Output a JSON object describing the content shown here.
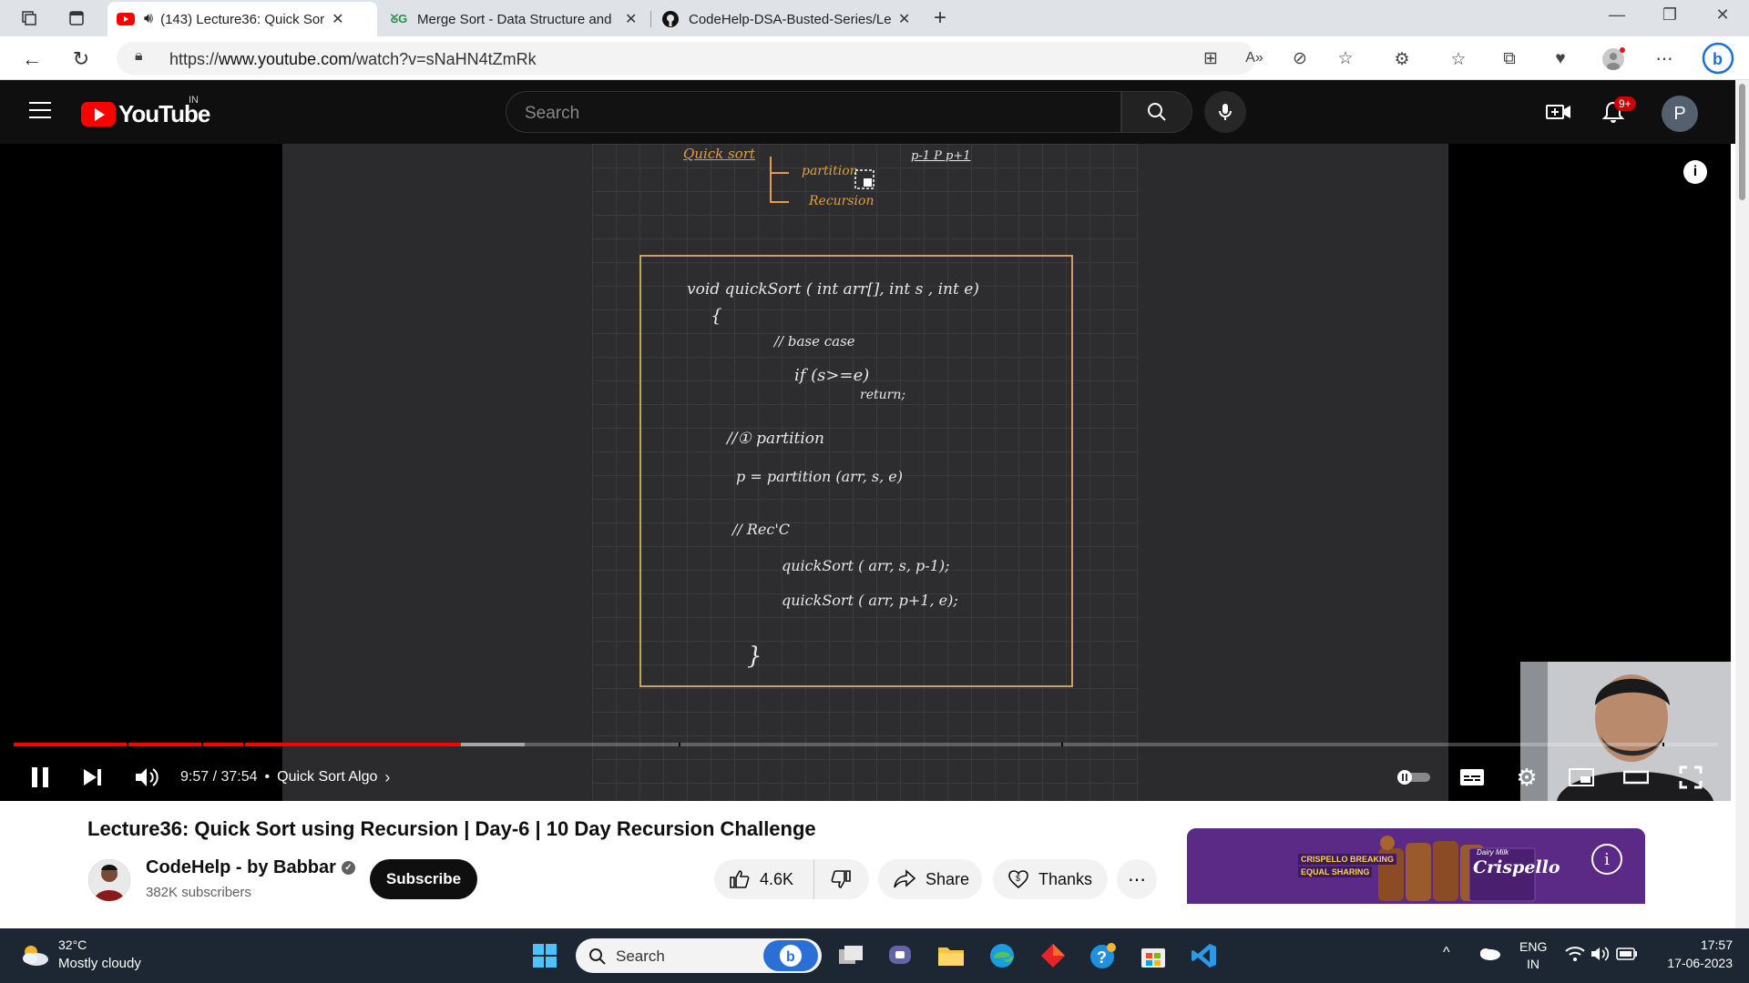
{
  "browser": {
    "tabs": [
      {
        "title": "(143) Lecture36: Quick Sort",
        "active": true
      },
      {
        "title": "Merge Sort - Data Structure and",
        "active": false
      },
      {
        "title": "CodeHelp-DSA-Busted-Series/Le",
        "active": false
      }
    ],
    "url_prefix": "https://",
    "url_domain": "www.youtube.com",
    "url_path": "/watch?v=sNaHN4tZmRk"
  },
  "youtube": {
    "logo_text": "YouTube",
    "country": "IN",
    "search_placeholder": "Search",
    "notification_count": "9+",
    "avatar_letter": "P"
  },
  "player": {
    "board": {
      "heading": "Quick sort",
      "branch1": "partition",
      "branch2": "Recursion",
      "top_right": "p-1  P  p+1",
      "code": [
        "void  quickSort ( int arr[], int s , int e)",
        "{",
        "// base case",
        "if (s>=e)",
        "return;",
        "//① partition",
        "p  = partition (arr, s, e)",
        "//  Rec'C",
        "quickSort ( arr, s,  p-1);",
        "quickSort ( arr, p+1, e);",
        "}"
      ]
    },
    "current_time": "9:57",
    "duration": "37:54",
    "time_display": "9:57 / 37:54",
    "chapter": "Quick Sort Algo",
    "progress_fraction": 0.2625,
    "buffered_fraction": 0.3
  },
  "video": {
    "title": "Lecture36: Quick Sort using Recursion | Day-6 | 10 Day Recursion Challenge",
    "channel": "CodeHelp - by Babbar",
    "subscribers": "382K subscribers",
    "subscribe_label": "Subscribe",
    "likes": "4.6K",
    "share_label": "Share",
    "thanks_label": "Thanks"
  },
  "ad": {
    "tagline_1": "CRISPELLO BREAKING",
    "tagline_2": "EQUAL SHARING",
    "brand": "Crispello",
    "sub_brand": "Dairy Milk"
  },
  "taskbar": {
    "temperature": "32°C",
    "weather": "Mostly cloudy",
    "search_placeholder": "Search",
    "language": "ENG",
    "region": "IN",
    "time": "17:57",
    "date": "17-06-2023"
  },
  "colors": {
    "yt_red": "#ff0000",
    "board_orange": "#e0a13a",
    "ad_purple": "#5b2a86"
  }
}
